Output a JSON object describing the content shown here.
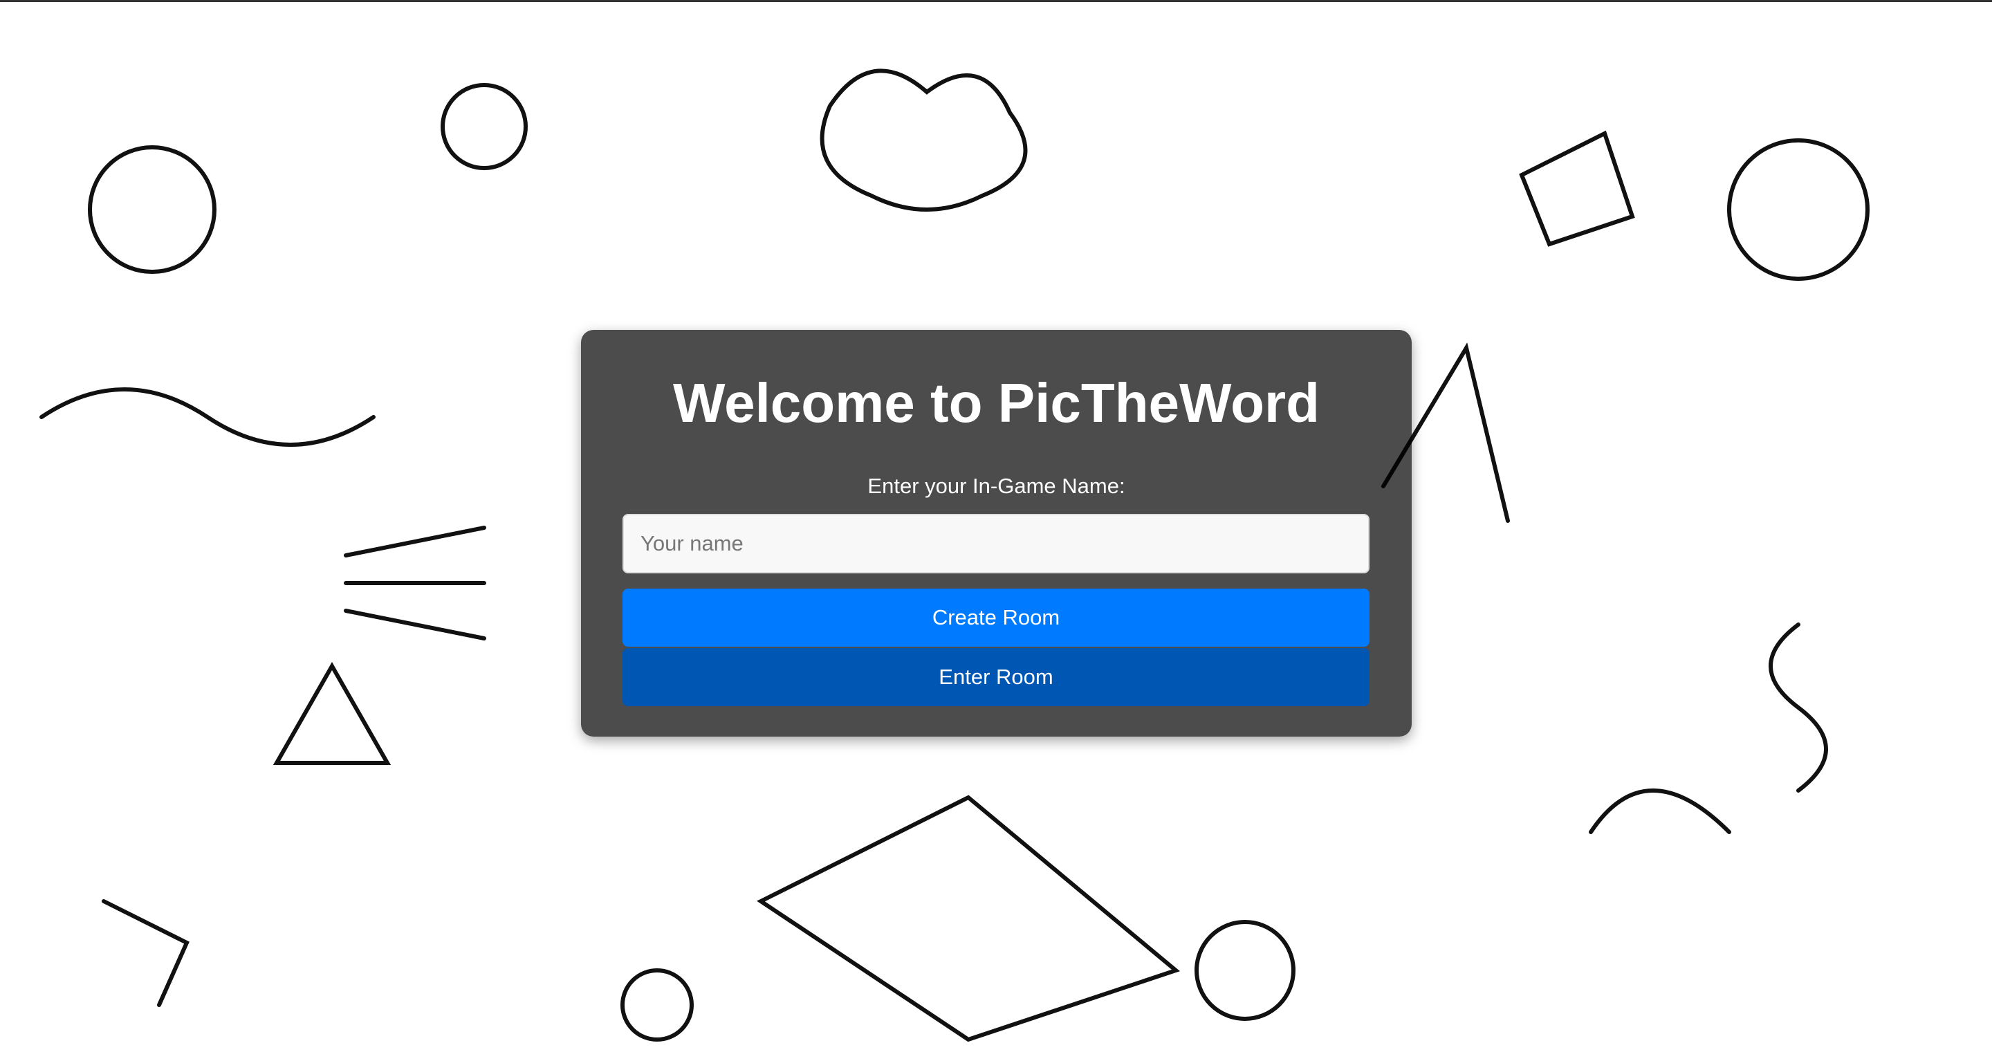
{
  "background": {
    "description_icon": "doodle-pattern",
    "color": "#ffffff"
  },
  "panel": {
    "title": "Welcome to PicTheWord",
    "name_label": "Enter your In-Game Name:",
    "name_input": {
      "value": "",
      "placeholder": "Your name"
    },
    "create_button": "Create Room",
    "enter_button": "Enter Room"
  },
  "colors": {
    "primary": "#007bff",
    "primary_dark": "#0056b3",
    "panel": "#4d4d4d"
  }
}
